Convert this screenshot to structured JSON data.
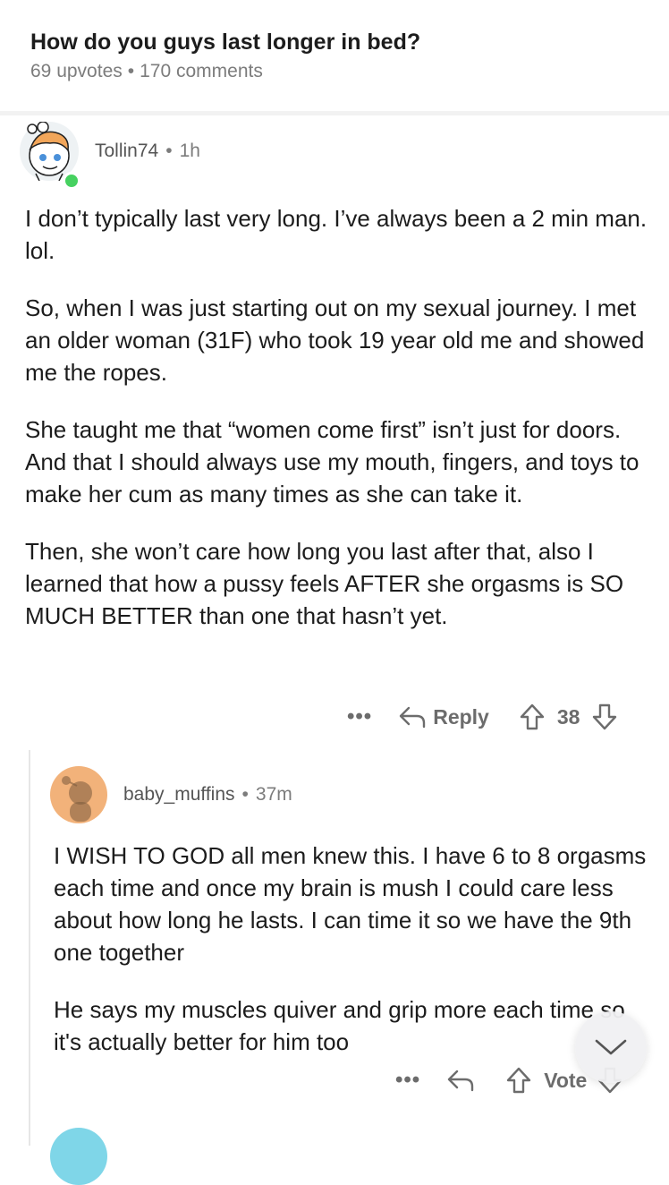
{
  "post": {
    "title": "How do you guys last longer in bed?",
    "upvotes": "69 upvotes",
    "separator": "•",
    "comments": "170 comments"
  },
  "comment1": {
    "username": "Tollin74",
    "time": "1h",
    "paragraphs": [
      "I don’t typically last very long.  I’ve always been a 2 min man. lol.",
      "So, when I was just starting out on my sexual journey.  I met an older woman (31F) who took 19 year old me and showed me the ropes.",
      "She taught me that “women come first” isn’t just for doors.   And that I should always use my mouth, fingers, and toys to make her cum as many times as she can take it.",
      "Then, she won’t care how long you last after that, also I learned that how a pussy feels AFTER she orgasms is SO MUCH BETTER than one that hasn’t yet."
    ],
    "more": "•••",
    "reply_label": "Reply",
    "score": "38"
  },
  "comment2": {
    "username": "baby_muffins",
    "time": "37m",
    "paragraphs": [
      "I WISH TO GOD all men knew this. I have 6 to 8 orgasms each time and once my brain is mush I could care less about how long he lasts. I can time it so we have the 9th one together",
      "He says my muscles quiver and grip more each time so it's actually better for him too"
    ],
    "more": "•••",
    "vote_label": "Vote"
  },
  "colors": {
    "online": "#46d160",
    "avatar2_bg": "#f2b27a",
    "avatar3_bg": "#7fd6e8"
  },
  "icons": [
    "snoo-avatar-icon",
    "online-indicator",
    "reply-icon",
    "upvote-icon",
    "downvote-icon",
    "scroll-down-icon"
  ]
}
